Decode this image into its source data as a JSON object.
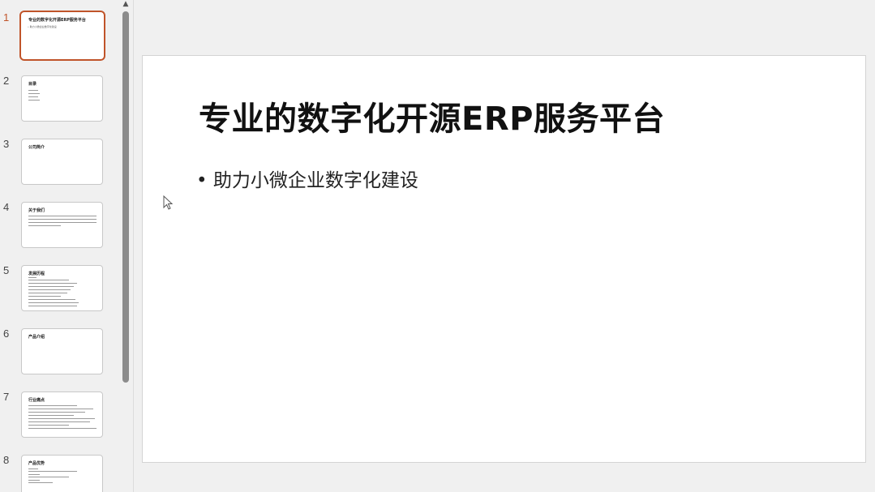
{
  "slides": [
    {
      "number": "1",
      "title": "专业的数字化开源ERP服务平台",
      "body": "• 助力小微企业数字化建设",
      "active": true
    },
    {
      "number": "2",
      "title": "目录",
      "body": ""
    },
    {
      "number": "3",
      "title": "公司简介",
      "body": ""
    },
    {
      "number": "4",
      "title": "关于我们",
      "body": ""
    },
    {
      "number": "5",
      "title": "发展历程",
      "body": ""
    },
    {
      "number": "6",
      "title": "产品介绍",
      "body": ""
    },
    {
      "number": "7",
      "title": "行业痛点",
      "body": ""
    },
    {
      "number": "8",
      "title": "产品优势",
      "body": ""
    }
  ],
  "current_slide": {
    "title": "专业的数字化开源ERP服务平台",
    "bullet": "• 助力小微企业数字化建设"
  },
  "colors": {
    "accent": "#c0542a"
  }
}
